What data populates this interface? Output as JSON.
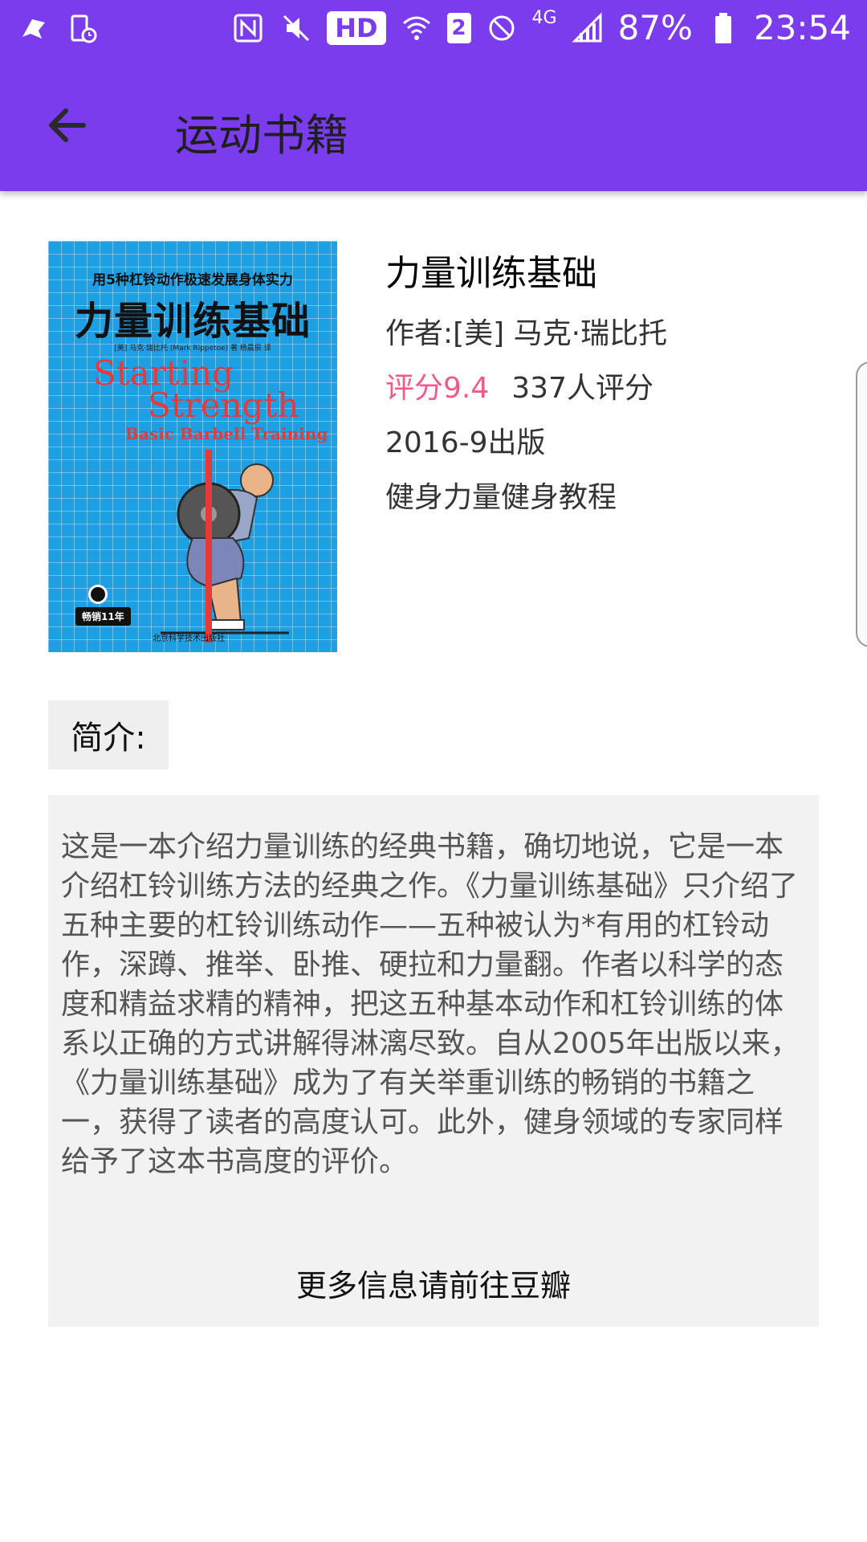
{
  "status_bar": {
    "battery_percent": "87%",
    "time": "23:54",
    "hd_label": "HD",
    "sim_slot": "2",
    "network_type": "4G",
    "icons": [
      "app-icon",
      "sim-timer-icon",
      "nfc-icon",
      "mute-icon",
      "hd-icon",
      "wifi-icon",
      "sim2-icon",
      "block-icon",
      "signal-icon",
      "battery-icon"
    ]
  },
  "app_bar": {
    "title": "运动书籍",
    "back_icon": "arrow-back-icon"
  },
  "book": {
    "title": "力量训练基础",
    "author": "作者:[美] 马克·瑞比托",
    "rating": "评分9.4",
    "rating_count": "337人评分",
    "pub_date": "2016-9出版",
    "tags": "健身力量健身教程"
  },
  "cover": {
    "top_line": "用5种杠铃动作极速发展身体实力",
    "title": "力量训练基础",
    "author_line": "[美] 马克·瑞比托 (Mark Rippetoe) 著    杨晨辰 译",
    "english_1": "Starting",
    "english_2": "Strength",
    "english_3": "Basic Barbell Training",
    "badge": "畅销11年",
    "publisher": "北京科学技术出版社"
  },
  "intro": {
    "label": "简介:",
    "text": "这是一本介绍力量训练的经典书籍，确切地说，它是一本介绍杠铃训练方法的经典之作。《力量训练基础》只介绍了五种主要的杠铃训练动作——五种被认为*有用的杠铃动作，深蹲、推举、卧推、硬拉和力量翻。作者以科学的态度和精益求精的精神，把这五种基本动作和杠铃训练的体系以正确的方式讲解得淋漓尽致。自从2005年出版以来，《力量训练基础》成为了有关举重训练的畅销的书籍之一，获得了读者的高度认可。此外，健身领域的专家同样给予了这本书高度的评价。",
    "more_link": "更多信息请前往豆瓣"
  },
  "colors": {
    "primary": "#7b3ced",
    "rating": "#ef5b86",
    "intro_bg": "#f2f2f2",
    "cover_bg": "#1f9fe3"
  }
}
